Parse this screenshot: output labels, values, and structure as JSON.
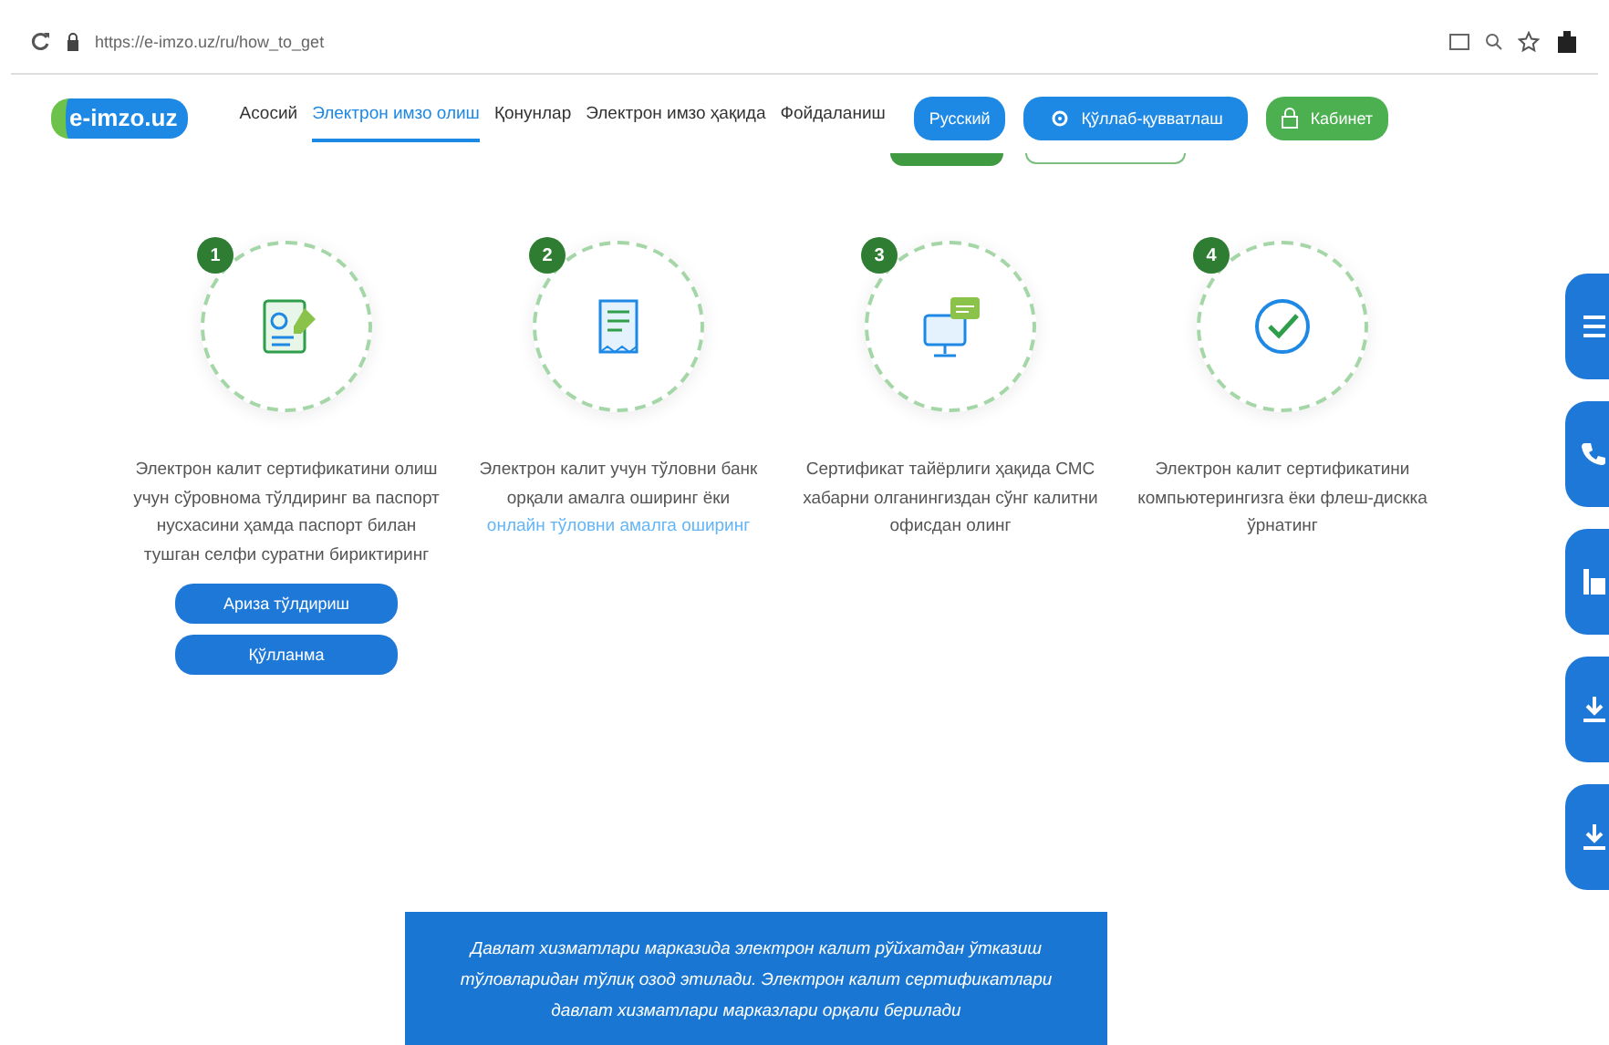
{
  "browser": {
    "url": "https://e-imzo.uz/ru/how_to_get"
  },
  "header": {
    "logo": {
      "prefix": "e-",
      "name": "imzo.uz"
    },
    "nav": [
      {
        "label": "Асосий",
        "selected": false
      },
      {
        "label": "Электрон имзо олиш",
        "selected": true
      },
      {
        "label": "Қонунлар",
        "selected": false
      },
      {
        "label": "Электрон имзо ҳақида",
        "selected": false
      },
      {
        "label": "Фойдаланиш",
        "selected": false
      }
    ],
    "buttons": [
      {
        "kind": "lang",
        "label": "Русский"
      },
      {
        "kind": "support",
        "label": "Қўллаб-қувватлаш"
      },
      {
        "kind": "cabinet",
        "label": "Кабинет"
      }
    ]
  },
  "steps": [
    {
      "number": "1",
      "text": "Электрон калит сертификатини олиш учун сўровнома тўлдиринг ва паспорт нусхасини ҳамда паспорт билан тушган селфи суратни бириктиринг",
      "buttons": [
        "Ариза тўлдириш",
        "Қўлланма"
      ]
    },
    {
      "number": "2",
      "text": "Электрон калит учун тўловни банк орқали амалга оширинг ёки",
      "link": "онлайн тўловни амалга оширинг"
    },
    {
      "number": "3",
      "text": "Сертификат тайёрлиги ҳақида СМС хабарни олганингиздан сўнг калитни офисдан олинг"
    },
    {
      "number": "4",
      "text": "Электрон калит сертификатини компьютерингизга ёки флеш-дискка ўрнатинг"
    }
  ],
  "notice": {
    "text": "Давлат хизматлари марказида электрон калит рўйхатдан ўтказиш тўловларидан тўлиқ озод этилади. Электрон калит сертификатлари давлат хизматлари марказлари орқали берилади"
  }
}
